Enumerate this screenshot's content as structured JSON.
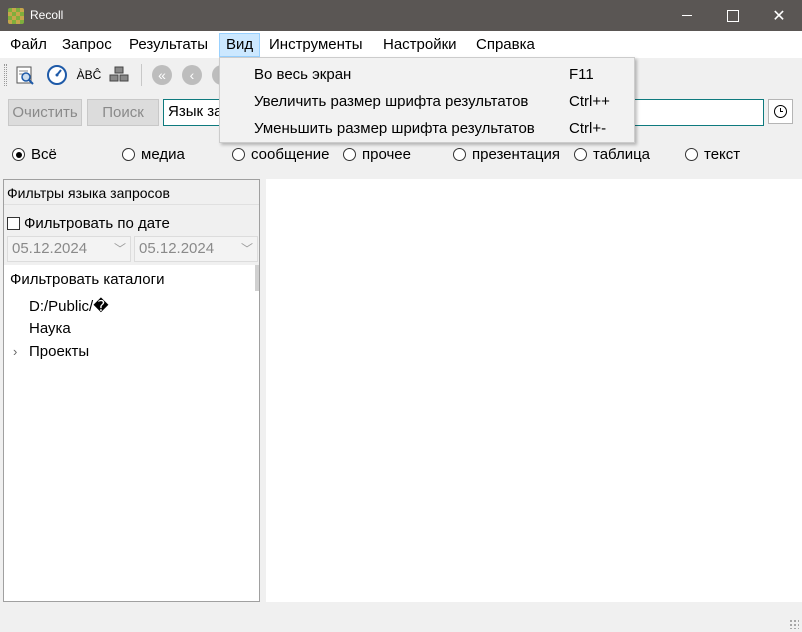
{
  "window": {
    "title": "Recoll"
  },
  "menubar": {
    "items": [
      "Файл",
      "Запрос",
      "Результаты",
      "Вид",
      "Инструменты",
      "Настройки",
      "Справка"
    ],
    "active": "Вид"
  },
  "view_menu": {
    "items": [
      {
        "label": "Во весь экран",
        "shortcut": "F11"
      },
      {
        "label": "Увеличить размер шрифта результатов",
        "shortcut": "Ctrl++"
      },
      {
        "label": "Уменьшить размер шрифта результатов",
        "shortcut": "Ctrl+-"
      }
    ]
  },
  "toolbar": {
    "icons": [
      "search-preview-icon",
      "clock-gauge-icon",
      "spelling-abc-icon",
      "database-stack-icon",
      "first-page-icon",
      "previous-page-icon",
      "next-page-icon"
    ],
    "abc_text": "ÀBĈ"
  },
  "search": {
    "clear_label": "Очистить",
    "search_label": "Поиск",
    "mode_value": "Язык запросов",
    "query_value": ""
  },
  "filters": {
    "radios": [
      "Всё",
      "медиа",
      "сообщение",
      "прочее",
      "презентация",
      "таблица",
      "текст"
    ],
    "selected": "Всё"
  },
  "left_panel": {
    "header": "Фильтры языка запросов",
    "date_filter_label": "Фильтровать по дате",
    "date_filter_checked": false,
    "date_from": "05.12.2024",
    "date_to": "05.12.2024",
    "dirs_label": "Фильтровать каталоги",
    "dirs": [
      "D:/Public/�",
      "Наука",
      "Проекты"
    ]
  }
}
